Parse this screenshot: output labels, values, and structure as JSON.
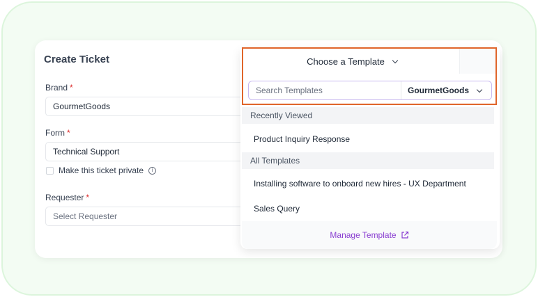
{
  "form": {
    "title": "Create Ticket",
    "brand": {
      "label": "Brand",
      "value": "GourmetGoods"
    },
    "form_field": {
      "label": "Form",
      "value": "Technical Support"
    },
    "private_label": "Make this ticket private",
    "requester": {
      "label": "Requester",
      "placeholder": "Select Requester"
    },
    "required_mark": "*"
  },
  "template_dropdown": {
    "title": "Choose a Template",
    "search_placeholder": "Search Templates",
    "brand_filter": "GourmetGoods",
    "recently_viewed_label": "Recently Viewed",
    "recently_viewed": [
      "Product Inquiry Response"
    ],
    "all_templates_label": "All Templates",
    "all_templates": [
      "Installing software to onboard new hires - UX Department",
      "Sales Query"
    ],
    "manage_label": "Manage Template"
  },
  "colors": {
    "highlight_border": "#e0652a",
    "accent": "#8a3fd1",
    "required": "#dc2626"
  }
}
